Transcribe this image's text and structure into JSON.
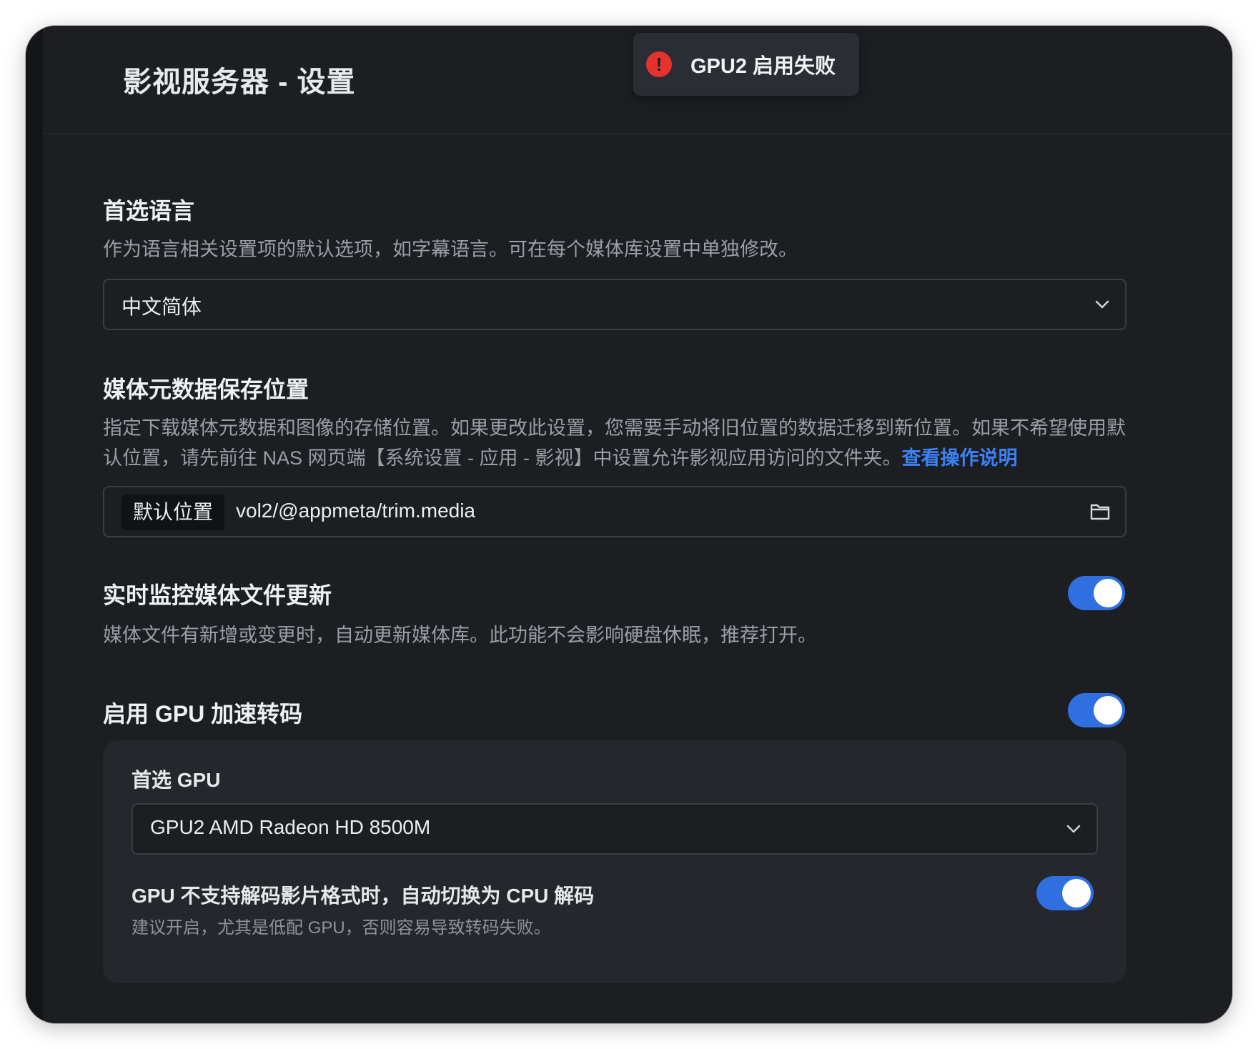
{
  "window": {
    "title": "影视服务器 - 设置"
  },
  "toast": {
    "icon": "error-icon",
    "message": "GPU2 启用失败",
    "color": "#e5322d"
  },
  "language": {
    "title": "首选语言",
    "description": "作为语言相关设置项的默认选项，如字幕语言。可在每个媒体库设置中单独修改。",
    "selected": "中文简体"
  },
  "metadata": {
    "title": "媒体元数据保存位置",
    "description": "指定下载媒体元数据和图像的存储位置。如果更改此设置，您需要手动将旧位置的数据迁移到新位置。如果不希望使用默认位置，请先前往 NAS 网页端【系统设置 - 应用 - 影视】中设置允许影视应用访问的文件夹。",
    "link": "查看操作说明",
    "path_tag": "默认位置",
    "path": "vol2/@appmeta/trim.media"
  },
  "monitor": {
    "title": "实时监控媒体文件更新",
    "description": "媒体文件有新增或变更时，自动更新媒体库。此功能不会影响硬盘休眠，推荐打开。",
    "enabled": true
  },
  "gpu": {
    "title": "启用 GPU 加速转码",
    "enabled": true,
    "preferred_label": "首选 GPU",
    "preferred_value": "GPU2 AMD Radeon HD 8500M",
    "fallback_label": "GPU 不支持解码影片格式时，自动切换为 CPU 解码",
    "fallback_desc": "建议开启，尤其是低配 GPU，否则容易导致转码失败。",
    "fallback_enabled": true
  },
  "colors": {
    "accent": "#2f6fe0",
    "link": "#3b82f6",
    "background": "#1c1e22"
  }
}
